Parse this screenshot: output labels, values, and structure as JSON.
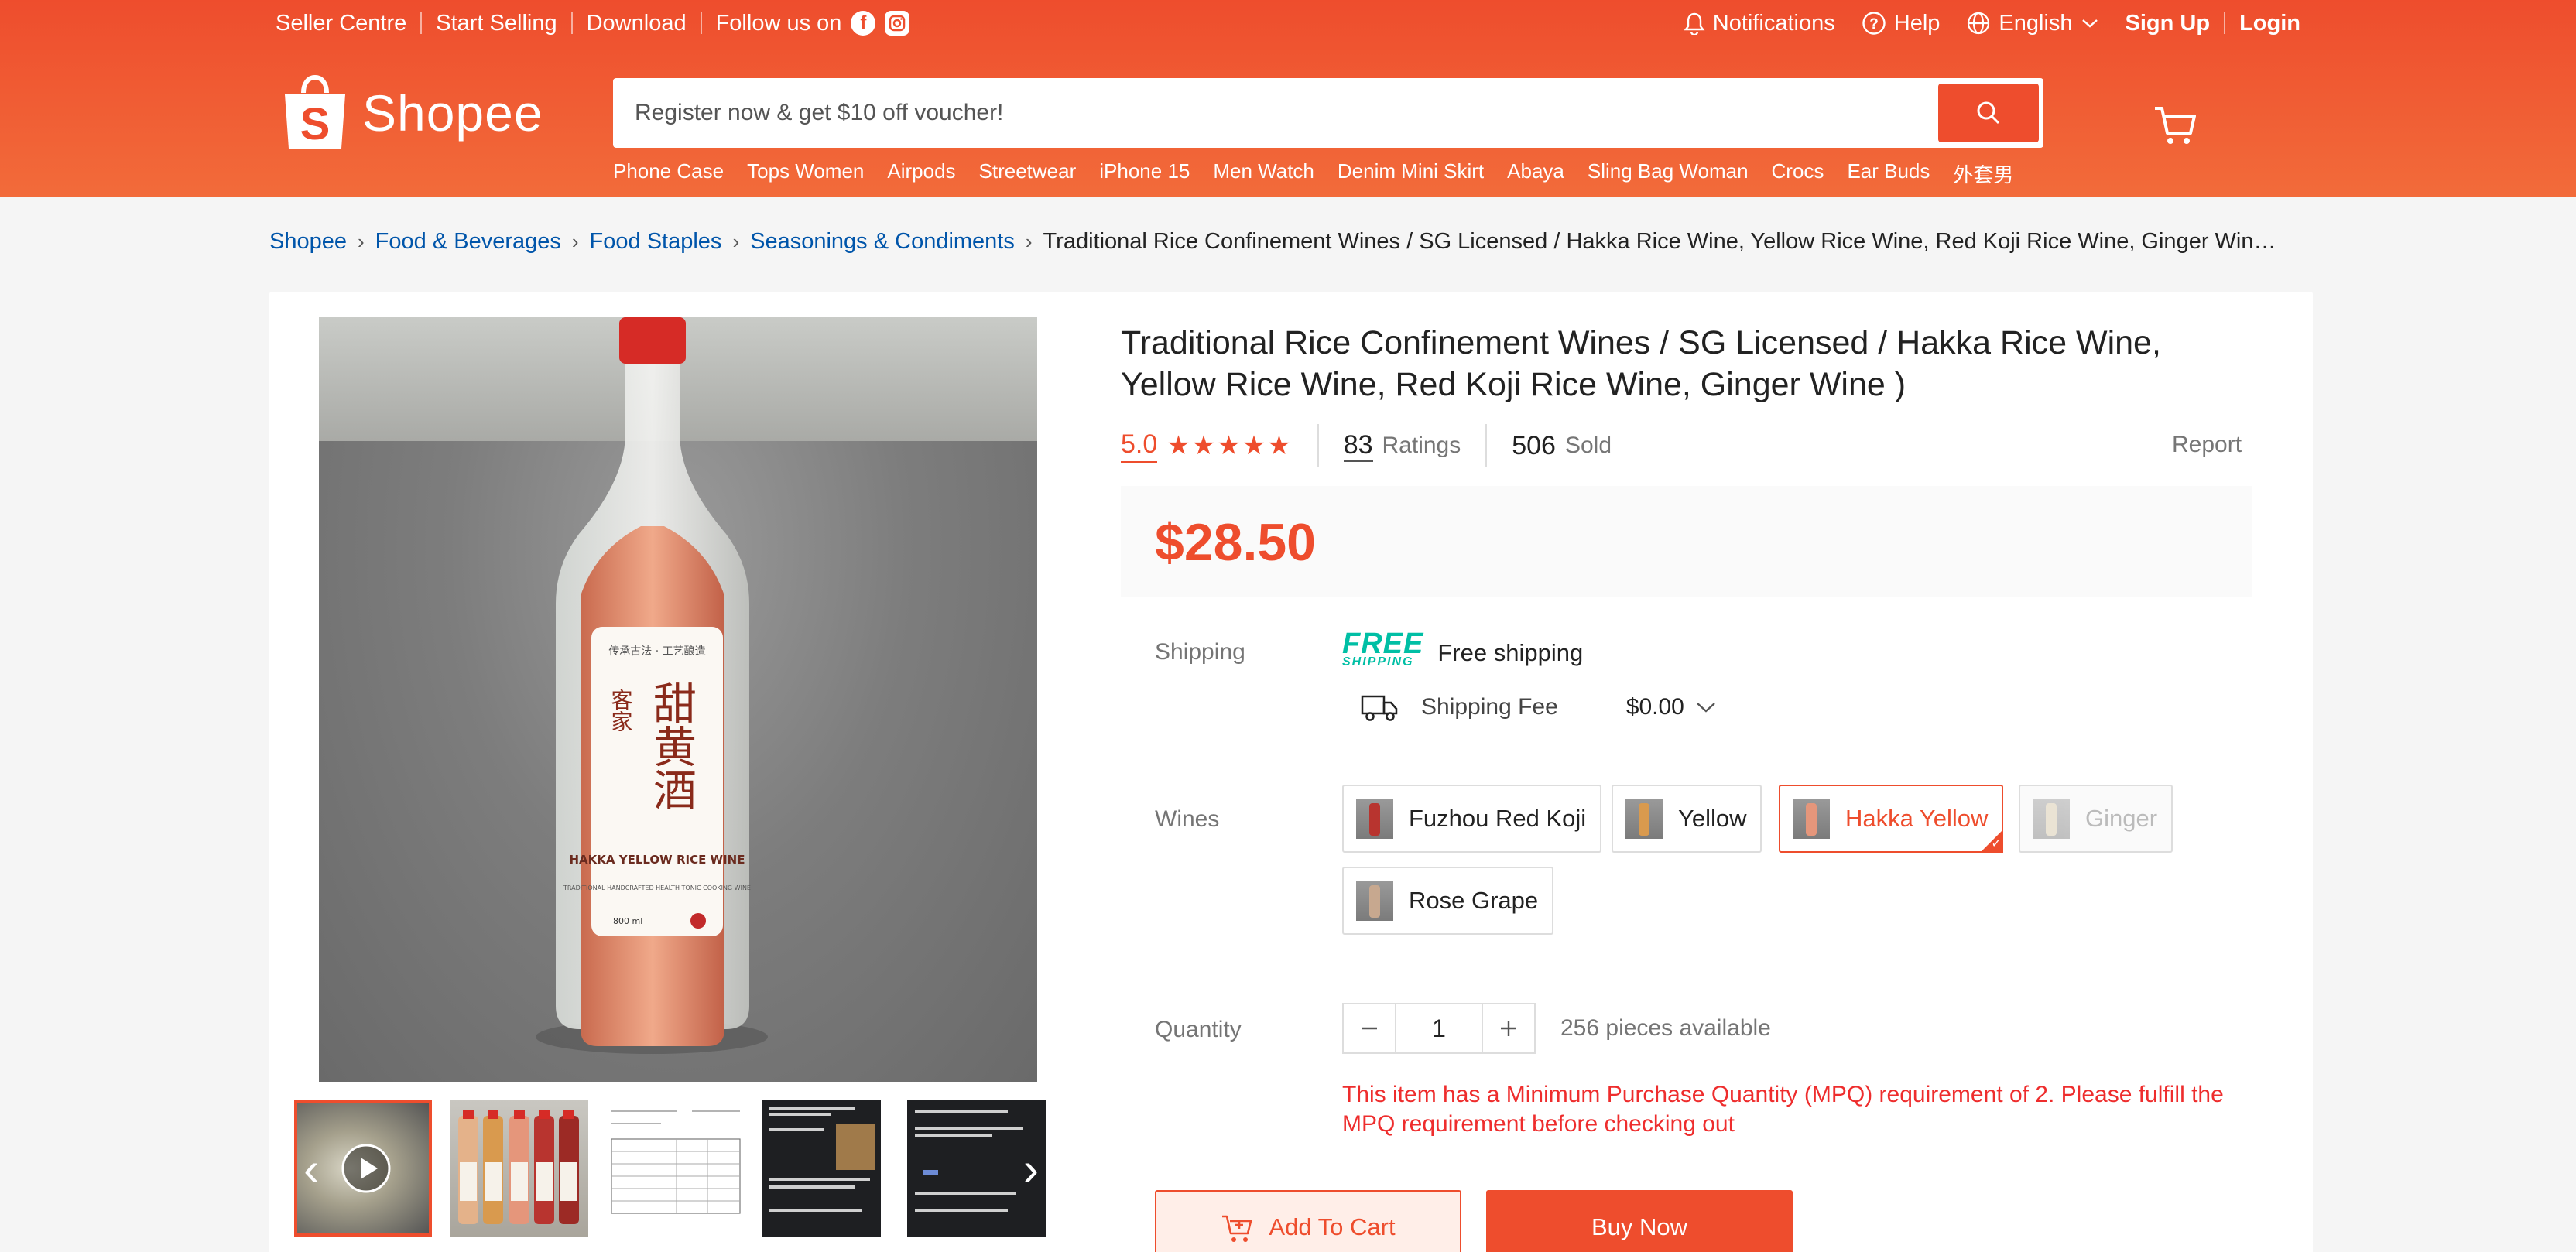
{
  "topbar": {
    "seller_centre": "Seller Centre",
    "start_selling": "Start Selling",
    "download": "Download",
    "follow_us": "Follow us on",
    "notifications": "Notifications",
    "help": "Help",
    "language": "English",
    "sign_up": "Sign Up",
    "login": "Login"
  },
  "logo": {
    "text": "Shopee"
  },
  "search": {
    "placeholder": "Register now & get $10 off voucher!"
  },
  "suggestions": [
    "Phone Case",
    "Tops Women",
    "Airpods",
    "Streetwear",
    "iPhone 15",
    "Men Watch",
    "Denim Mini Skirt",
    "Abaya",
    "Sling Bag Woman",
    "Crocs",
    "Ear Buds",
    "外套男"
  ],
  "breadcrumb": {
    "items": [
      "Shopee",
      "Food & Beverages",
      "Food Staples",
      "Seasonings & Condiments"
    ],
    "current": "Traditional Rice Confinement Wines / SG Licensed / Hakka Rice Wine, Yellow Rice Wine, Red Koji Rice Wine, Ginger Win…"
  },
  "product": {
    "title": "Traditional Rice Confinement Wines / SG Licensed / Hakka Rice Wine, Yellow Rice Wine, Red Koji Rice Wine, Ginger Wine )",
    "rating": "5.0",
    "stars": 5,
    "ratings_count": "83",
    "ratings_label": "Ratings",
    "sold_count": "506",
    "sold_label": "Sold",
    "report": "Report",
    "price": "$28.50",
    "label_cn_top": "传承古法 · 工艺酿造",
    "label_cn_side": "客家",
    "label_cn_main": "甜黄酒",
    "label_en": "HAKKA YELLOW RICE WINE",
    "label_en_sub": "TRADITIONAL HANDCRAFTED HEALTH TONIC COOKING WINE",
    "label_volume": "800 ml"
  },
  "shipping": {
    "label": "Shipping",
    "free_logo_top": "FREE",
    "free_logo_bottom": "SHIPPING",
    "free_text": "Free shipping",
    "fee_label": "Shipping Fee",
    "fee_value": "$0.00"
  },
  "variations": {
    "label": "Wines",
    "options": [
      {
        "label": "Fuzhou Red Koji",
        "state": "normal",
        "liquid": "#b8342f"
      },
      {
        "label": "Yellow",
        "state": "normal",
        "liquid": "#d99a4e"
      },
      {
        "label": "Hakka Yellow",
        "state": "selected",
        "liquid": "#e5967b"
      },
      {
        "label": "Ginger",
        "state": "disabled",
        "liquid": "#d8c8a8"
      },
      {
        "label": "Rose Grape",
        "state": "normal",
        "liquid": "#c7a88f"
      }
    ]
  },
  "quantity": {
    "label": "Quantity",
    "value": "1",
    "available": "256 pieces available",
    "mpq_warning": "This item has a Minimum Purchase Quantity (MPQ) requirement of 2. Please fulfill the MPQ requirement before checking out"
  },
  "actions": {
    "add_to_cart": "Add To Cart",
    "buy_now": "Buy Now"
  },
  "colors": {
    "brand": "#ee4d2d",
    "free_shipping": "#00bfa5",
    "link": "#0055aa"
  }
}
